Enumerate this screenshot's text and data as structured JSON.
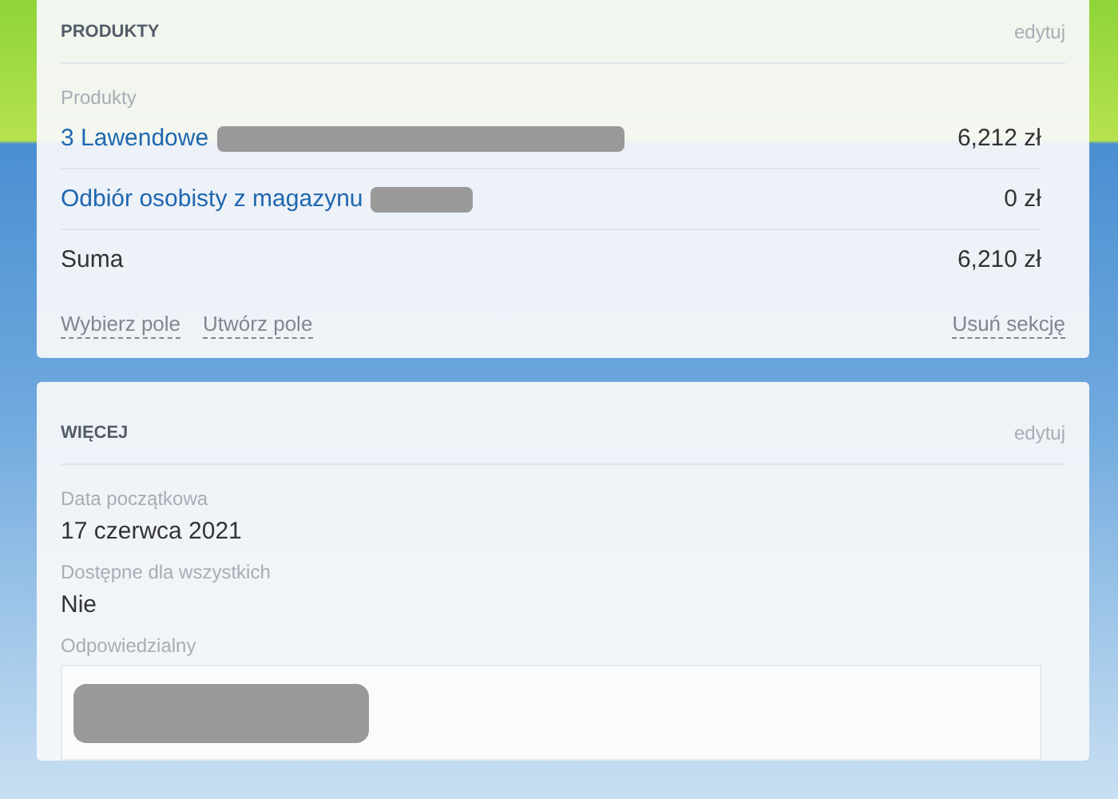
{
  "products_section": {
    "title": "PRODUKTY",
    "edit_link": "edytuj",
    "field_label": "Produkty",
    "rows": [
      {
        "kind": "link",
        "name": "3 Lawendowe",
        "amount": "6,212 zł"
      },
      {
        "kind": "link",
        "name": "Odbiór osobisty z magazynu",
        "amount": "0 zł"
      },
      {
        "kind": "total",
        "name": "Suma",
        "amount": "6,210 zł"
      }
    ],
    "actions": [
      "Wybierz pole",
      "Utwórz pole"
    ],
    "remove_link": "Usuń sekcję"
  },
  "more_section": {
    "title": "WIĘCEJ",
    "edit_link": "edytuj",
    "fields": [
      {
        "kind": "text",
        "label": "Data początkowa",
        "value": "17 czerwca 2021"
      },
      {
        "kind": "text",
        "label": "Dostępne dla wszystkich",
        "value": "Nie"
      },
      {
        "kind": "person",
        "label": "Odpowiedzialny"
      }
    ]
  }
}
